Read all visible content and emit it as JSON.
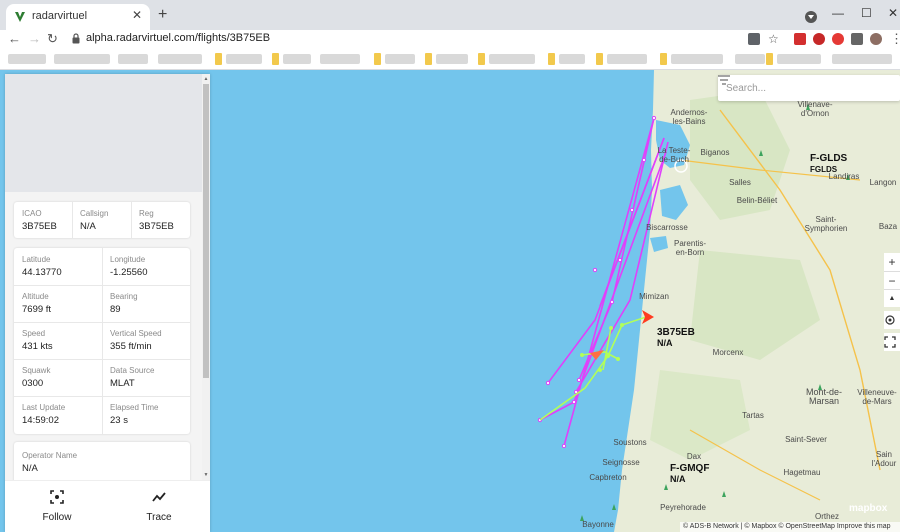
{
  "browser": {
    "tab_title": "radarvirtuel",
    "url": "alpha.radarvirtuel.com/flights/3B75EB",
    "accent": "#1a73e8"
  },
  "map": {
    "search_placeholder": "Search...",
    "zoom_in": "+",
    "zoom_out": "−",
    "compass": "▲",
    "labels": {
      "andernos": "Andernos-\nles-Bains",
      "villenave": "Villenave-\nd'Ornon",
      "la_teste": "La Teste-\nde-Buch",
      "biganos": "Biganos",
      "salles": "Salles",
      "belin": "Belin-Béliet",
      "landiras": "Landiras",
      "langon": "Langon",
      "bazas": "Baza",
      "biscarrosse": "Biscarrosse",
      "parentis": "Parentis-\nen-Born",
      "saint_symphorien": "Saint-\nSymphorien",
      "mimizan": "Mimizan",
      "morcenx": "Morcenx",
      "mont_de_marsan": "Mont-de-\nMarsan",
      "villeneuve": "Villeneuve-\nde-Mars",
      "tartas": "Tartas",
      "soustons": "Soustons",
      "saint_sever": "Saint-Sever",
      "dax": "Dax",
      "seignosse": "Seignosse",
      "hagetmau": "Hagetmau",
      "saint_pierre": "Sain\nl'Adour",
      "capbreton": "Capbreton",
      "peyrehorade": "Peyrehorade",
      "bayonne": "Bayonne",
      "orthez": "Orthez"
    },
    "aircraft": [
      {
        "id": "3B75EB",
        "sub": "N/A",
        "color": "#ff3b20"
      },
      {
        "id": "F-GLDS",
        "sub": "FGLDS"
      },
      {
        "id": "F-GMQF",
        "sub": "N/A"
      }
    ],
    "mapbox_logo": "mapbox",
    "attribution": "© ADS-B Network | © Mapbox © OpenStreetMap  Improve this map",
    "trail_color": "#e040fb",
    "trail_color_alt": "#b2ff59",
    "sea_color": "#73c5ec",
    "land_color": "#e8ecd8"
  },
  "panel": {
    "id_row": [
      {
        "label": "ICAO",
        "value": "3B75EB"
      },
      {
        "label": "Callsign",
        "value": "N/A"
      },
      {
        "label": "Reg",
        "value": "3B75EB"
      }
    ],
    "details": [
      {
        "label": "Latitude",
        "value": "44.13770"
      },
      {
        "label": "Longitude",
        "value": "-1.25560"
      },
      {
        "label": "Altitude",
        "value": "7699 ft"
      },
      {
        "label": "Bearing",
        "value": "89"
      },
      {
        "label": "Speed",
        "value": "431 kts"
      },
      {
        "label": "Vertical Speed",
        "value": "355 ft/min"
      },
      {
        "label": "Squawk",
        "value": "0300"
      },
      {
        "label": "Data Source",
        "value": "MLAT"
      },
      {
        "label": "Last Update",
        "value": "14:59:02"
      },
      {
        "label": "Elapsed Time",
        "value": "23 s"
      }
    ],
    "operator": {
      "label": "Operator Name",
      "value": "N/A"
    },
    "footer": {
      "follow": "Follow",
      "trace": "Trace"
    }
  }
}
